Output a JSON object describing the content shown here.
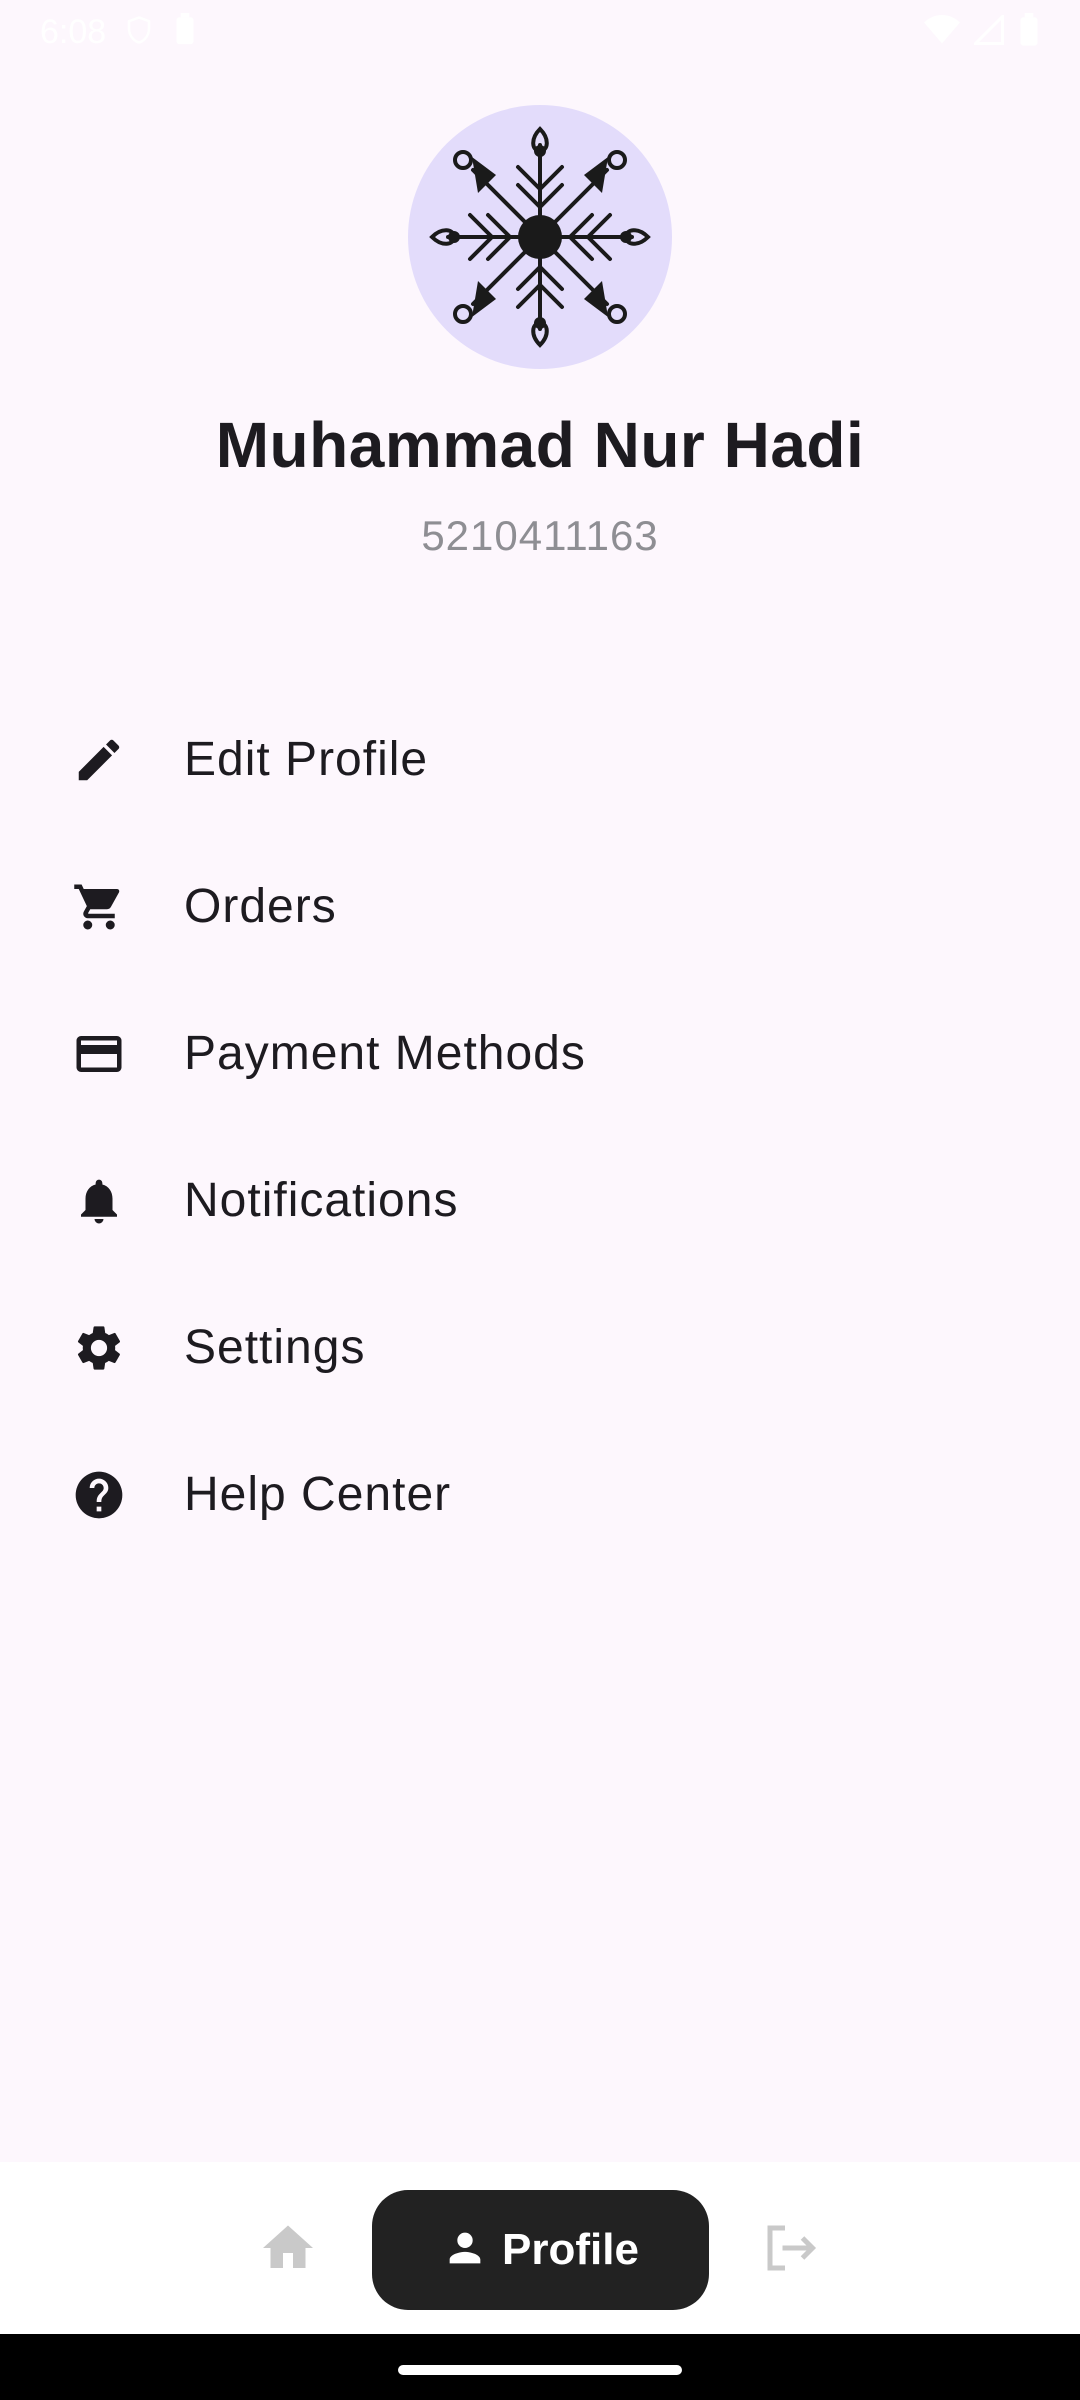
{
  "status_bar": {
    "time": "6:08",
    "icons": [
      "shield-icon",
      "battery-saver-icon",
      "wifi-icon",
      "signal-icon",
      "battery-icon"
    ]
  },
  "profile": {
    "avatar_icon": "snowflake-ornament-icon",
    "avatar_bg": "#e3dcfb",
    "name": "Muhammad Nur Hadi",
    "id": "5210411163"
  },
  "menu": {
    "items": [
      {
        "label": "Edit Profile",
        "icon": "edit-icon"
      },
      {
        "label": "Orders",
        "icon": "cart-icon"
      },
      {
        "label": "Payment Methods",
        "icon": "credit-card-icon"
      },
      {
        "label": "Notifications",
        "icon": "bell-icon"
      },
      {
        "label": "Settings",
        "icon": "gear-icon"
      },
      {
        "label": "Help Center",
        "icon": "help-icon"
      }
    ]
  },
  "bottom_nav": {
    "home_icon": "home-icon",
    "profile_label": "Profile",
    "profile_icon": "person-icon",
    "logout_icon": "logout-icon",
    "active_bg": "#222222"
  }
}
